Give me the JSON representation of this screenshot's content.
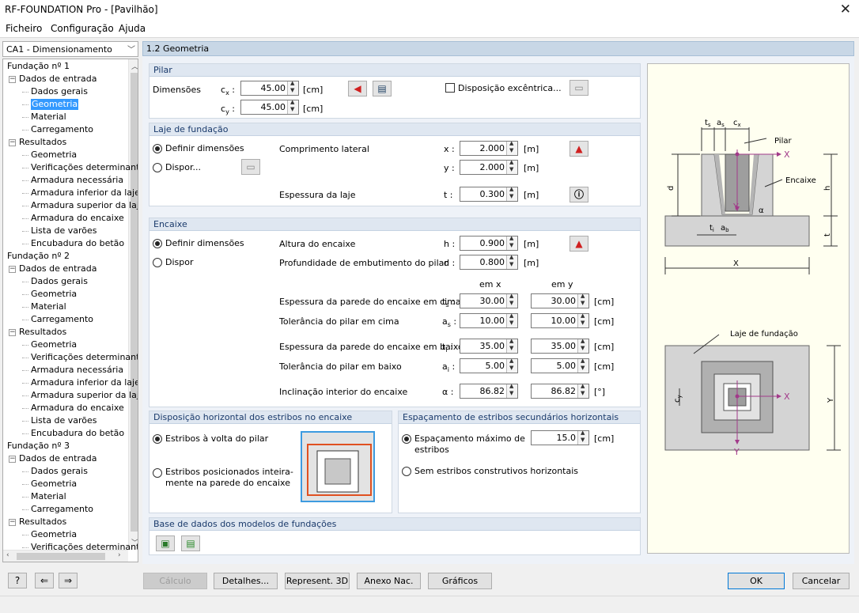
{
  "window": {
    "title": "RF-FOUNDATION Pro - [Pavilhão]",
    "close": "✕"
  },
  "menu": [
    "Ficheiro",
    "Configuração",
    "Ajuda"
  ],
  "case_select": "CA1 - Dimensionamento",
  "tree": [
    {
      "label": "Fundação nº 1",
      "level": 0,
      "exp": false
    },
    {
      "label": "Dados de entrada",
      "level": 1,
      "exp": true
    },
    {
      "label": "Dados gerais",
      "level": 2
    },
    {
      "label": "Geometria",
      "level": 2,
      "selected": true
    },
    {
      "label": "Material",
      "level": 2
    },
    {
      "label": "Carregamento",
      "level": 2
    },
    {
      "label": "Resultados",
      "level": 1,
      "exp": true
    },
    {
      "label": "Geometria",
      "level": 2
    },
    {
      "label": "Verificações determinantes",
      "level": 2
    },
    {
      "label": "Armadura necessária",
      "level": 2
    },
    {
      "label": "Armadura inferior da laje",
      "level": 2
    },
    {
      "label": "Armadura superior da laje",
      "level": 2
    },
    {
      "label": "Armadura do encaixe",
      "level": 2
    },
    {
      "label": "Lista de varões",
      "level": 2
    },
    {
      "label": "Encubadura do betão",
      "level": 2
    },
    {
      "label": "Fundação nº 2",
      "level": 0,
      "exp": false
    },
    {
      "label": "Dados de entrada",
      "level": 1,
      "exp": true
    },
    {
      "label": "Dados gerais",
      "level": 2
    },
    {
      "label": "Geometria",
      "level": 2
    },
    {
      "label": "Material",
      "level": 2
    },
    {
      "label": "Carregamento",
      "level": 2
    },
    {
      "label": "Resultados",
      "level": 1,
      "exp": true
    },
    {
      "label": "Geometria",
      "level": 2
    },
    {
      "label": "Verificações determinantes",
      "level": 2
    },
    {
      "label": "Armadura necessária",
      "level": 2
    },
    {
      "label": "Armadura inferior da laje",
      "level": 2
    },
    {
      "label": "Armadura superior da laje",
      "level": 2
    },
    {
      "label": "Armadura do encaixe",
      "level": 2
    },
    {
      "label": "Lista de varões",
      "level": 2
    },
    {
      "label": "Encubadura do betão",
      "level": 2
    },
    {
      "label": "Fundação nº 3",
      "level": 0,
      "exp": false
    },
    {
      "label": "Dados de entrada",
      "level": 1,
      "exp": true
    },
    {
      "label": "Dados gerais",
      "level": 2
    },
    {
      "label": "Geometria",
      "level": 2
    },
    {
      "label": "Material",
      "level": 2
    },
    {
      "label": "Carregamento",
      "level": 2
    },
    {
      "label": "Resultados",
      "level": 1,
      "exp": true
    },
    {
      "label": "Geometria",
      "level": 2
    },
    {
      "label": "Verificações determinantes",
      "level": 2
    }
  ],
  "section_title": "1.2 Geometria",
  "pilar": {
    "title": "Pilar",
    "dim_label": "Dimensões",
    "cx_label": "c",
    "cx_sub": "x",
    "cx": "45.00",
    "cy_label": "c",
    "cy_sub": "y",
    "cy": "45.00",
    "unit": "[cm]",
    "eccentric": "Disposição excêntrica..."
  },
  "laje": {
    "title": "Laje de fundação",
    "opt1": "Definir dimensões",
    "opt2": "Dispor...",
    "comp": "Comprimento lateral",
    "x_label": "x :",
    "x": "2.000",
    "y_label": "y :",
    "y": "2.000",
    "esp": "Espessura da laje",
    "t_label": "t :",
    "t": "0.300",
    "unit": "[m]"
  },
  "encaixe": {
    "title": "Encaixe",
    "opt1": "Definir dimensões",
    "opt2": "Dispor",
    "altura": "Altura do encaixe",
    "h_label": "h :",
    "h": "0.900",
    "prof": "Profundidade de embutimento do pilar",
    "d_label": "d :",
    "d": "0.800",
    "unit_m": "[m]",
    "col_x": "em x",
    "col_y": "em y",
    "rows": [
      {
        "label": "Espessura da parede do encaixe em cima",
        "sym": "t",
        "sub": "s",
        "vx": "30.00",
        "vy": "30.00",
        "unit": "[cm]"
      },
      {
        "label": "Tolerância do pilar em cima",
        "sym": "a",
        "sub": "s",
        "vx": "10.00",
        "vy": "10.00",
        "unit": "[cm]"
      },
      {
        "label": "Espessura da parede do encaixe em baixo",
        "sym": "t",
        "sub": "i",
        "vx": "35.00",
        "vy": "35.00",
        "unit": "[cm]"
      },
      {
        "label": "Tolerância do pilar em baixo",
        "sym": "a",
        "sub": "i",
        "vx": "5.00",
        "vy": "5.00",
        "unit": "[cm]"
      },
      {
        "label": "Inclinação interior do encaixe",
        "sym": "α",
        "sub": "",
        "vx": "86.82",
        "vy": "86.82",
        "unit": "[°]"
      }
    ]
  },
  "estribos": {
    "title": "Disposição horizontal dos estribos no encaixe",
    "opt1": "Estribos à volta do pilar",
    "opt2a": "Estribos posicionados inteira-",
    "opt2b": "mente na parede do encaixe"
  },
  "espac": {
    "title": "Espaçamento de estribos secundários horizontais",
    "opt1a": "Espaçamento máximo de",
    "opt1b": "estribos",
    "value": "15.0",
    "unit": "[cm]",
    "opt2": "Sem estribos construtivos horizontais"
  },
  "base": {
    "title": "Base de dados dos modelos de fundações"
  },
  "figure": {
    "pilar": "Pilar",
    "encaixe": "Encaixe",
    "laje": "Laje de fundação",
    "X": "X",
    "Y": "Y",
    "d": "d",
    "h": "h",
    "t": "t",
    "ts": "t",
    "as": "a",
    "cx": "c",
    "ti": "t",
    "ab": "a",
    "cy": "c",
    "alpha": "α"
  },
  "buttons": {
    "calc": "Cálculo",
    "detalhes": "Detalhes...",
    "rep3d": "Represent. 3D",
    "anexo": "Anexo Nac.",
    "graficos": "Gráficos",
    "ok": "OK",
    "cancel": "Cancelar"
  }
}
